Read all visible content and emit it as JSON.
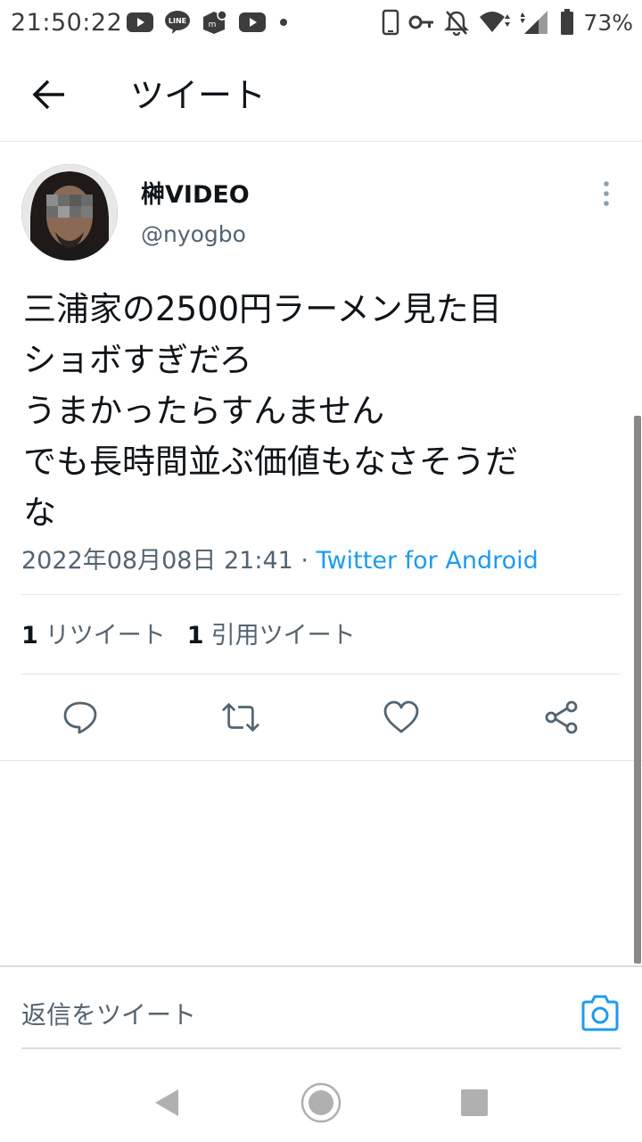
{
  "status_bar": {
    "time": "21:50:22",
    "battery_percent": "73%",
    "left_icons": [
      "youtube-icon",
      "line-icon",
      "app-icon",
      "youtube-icon",
      "dot-icon"
    ],
    "right_icons": [
      "phone-icon",
      "key-icon",
      "bell-off-icon",
      "wifi-icon",
      "signal-icon",
      "battery-icon"
    ]
  },
  "header": {
    "title": "ツイート"
  },
  "tweet": {
    "author_name": "榊VIDEO",
    "author_handle": "@nyogbo",
    "text_lines": [
      "三浦家の2500円ラーメン見た目",
      "ショボすぎだろ",
      "うまかったらすんません",
      "でも長時間並ぶ価値もなさそうだ",
      "な"
    ],
    "timestamp": "2022年08月08日 21:41",
    "separator": " · ",
    "source": "Twitter for Android",
    "stats": {
      "retweet_count": "1",
      "retweet_label": "リツイート",
      "quote_count": "1",
      "quote_label": "引用ツイート"
    },
    "actions": [
      "reply-icon",
      "retweet-icon",
      "like-icon",
      "share-icon"
    ]
  },
  "reply": {
    "placeholder": "返信をツイート"
  },
  "colors": {
    "accent": "#1d9bf0",
    "text": "#0f1419",
    "secondary": "#536471",
    "divider": "#e1e6ea"
  }
}
